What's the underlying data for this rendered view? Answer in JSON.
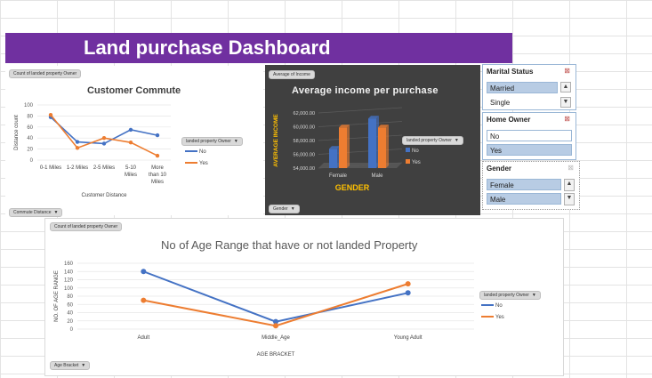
{
  "dashboard": {
    "title": "Land purchase Dashboard"
  },
  "commute_chart": {
    "field_value": "Count of landed property Owner",
    "title": "Customer Commute",
    "ylabel": "Distance count",
    "xlabel": "Customer Distance",
    "legend_field": "landed property Owner",
    "axis_field": "Commute Distance",
    "yticks": [
      "0",
      "20",
      "40",
      "60",
      "80",
      "100"
    ],
    "categories": [
      [
        "0-1 Miles"
      ],
      [
        "1-2 Miles"
      ],
      [
        "2-5 Miles"
      ],
      [
        "5-10",
        "Miles"
      ],
      [
        "More",
        "than 10",
        "Miles"
      ]
    ]
  },
  "income_chart": {
    "field_value": "Average of Income",
    "title": "Average income per purchase",
    "ylabel": "AVERAGE INCOME",
    "xlabel": "GENDER",
    "legend_field": "landed property Owner",
    "axis_field": "Gender",
    "yticks": [
      "54,000.00",
      "56,000.00",
      "58,000.00",
      "60,000.00",
      "62,000.00"
    ],
    "categories": [
      "Female",
      "Male"
    ]
  },
  "age_chart": {
    "field_value": "Count of landed property Owner",
    "title": "No of Age Range that have or not landed Property",
    "ylabel": "NO. OF AGE RANGE",
    "xlabel": "AGE BRACKET",
    "legend_field": "landed property Owner",
    "axis_field": "Age Bracket",
    "yticks": [
      "0",
      "20",
      "40",
      "60",
      "80",
      "100",
      "120",
      "140",
      "160"
    ],
    "categories": [
      "Adult",
      "Middle_Age",
      "Young Adult"
    ]
  },
  "colors": {
    "no": "#4472c4",
    "yes": "#ed7d31",
    "banner": "#7030a0",
    "income_bg": "#404040"
  },
  "chart_data": [
    {
      "type": "line",
      "title": "Customer Commute",
      "xlabel": "Customer Distance",
      "ylabel": "Distance count",
      "categories": [
        "0-1 Miles",
        "1-2 Miles",
        "2-5 Miles",
        "5-10 Miles",
        "More than 10 Miles"
      ],
      "series": [
        {
          "name": "No",
          "values": [
            78,
            33,
            30,
            55,
            45
          ]
        },
        {
          "name": "Yes",
          "values": [
            82,
            22,
            40,
            32,
            8
          ]
        }
      ],
      "ylim": [
        0,
        100
      ],
      "grid": true,
      "legend": "right"
    },
    {
      "type": "bar",
      "title": "Average income per purchase",
      "xlabel": "GENDER",
      "ylabel": "AVERAGE INCOME",
      "categories": [
        "Female",
        "Male"
      ],
      "series": [
        {
          "name": "No",
          "values": [
            56800,
            61200
          ]
        },
        {
          "name": "Yes",
          "values": [
            59900,
            59900
          ]
        }
      ],
      "ylim": [
        54000,
        62000
      ],
      "grid": true,
      "legend": "right"
    },
    {
      "type": "line",
      "title": "No of Age Range that have or not landed Property",
      "xlabel": "AGE BRACKET",
      "ylabel": "NO. OF AGE RANGE",
      "categories": [
        "Adult",
        "Middle_Age",
        "Young Adult"
      ],
      "series": [
        {
          "name": "No",
          "values": [
            140,
            18,
            88
          ]
        },
        {
          "name": "Yes",
          "values": [
            70,
            8,
            110
          ]
        }
      ],
      "ylim": [
        0,
        160
      ],
      "grid": true,
      "legend": "right"
    }
  ],
  "slicers": {
    "marital": {
      "header": "Marital Status",
      "items": [
        "Married",
        "Single"
      ]
    },
    "home": {
      "header": "Home Owner",
      "items": [
        "No",
        "Yes"
      ]
    },
    "gender": {
      "header": "Gender",
      "items": [
        "Female",
        "Male"
      ]
    }
  }
}
